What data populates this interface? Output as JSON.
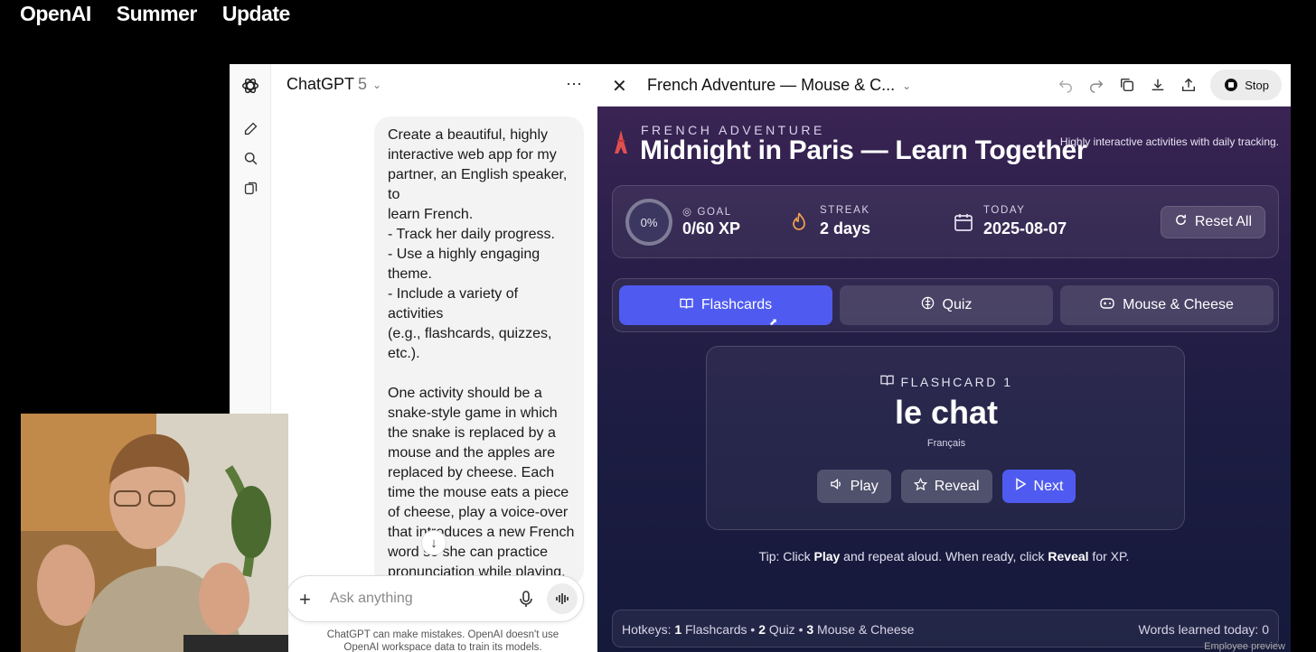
{
  "banner": {
    "words": [
      "OpenAI",
      "Summer",
      "Update"
    ]
  },
  "chat": {
    "model_name": "ChatGPT",
    "model_version": "5",
    "prompt": "Create a beautiful, highly\ninteractive web app for my\npartner, an English speaker, to\nlearn French.\n- Track her daily progress.\n- Use a highly engaging\ntheme.\n- Include a variety of activities\n(e.g., flashcards, quizzes,\netc.).\n\nOne activity should be a\nsnake-style game in which\nthe snake is replaced by a\nmouse and the apples are\nreplaced by cheese. Each\ntime the mouse eats a piece\nof cheese, play a voice-over\nthat introduces a new French\nword so she can practice\npronunciation while playing.\nMake it controllable with the\narrow keys.",
    "composer_placeholder": "Ask anything",
    "disclaimer": "ChatGPT can make mistakes. OpenAI doesn't use OpenAI workspace data to train its models."
  },
  "canvas": {
    "title": "French Adventure — Mouse & C...",
    "stop_label": "Stop",
    "eyebrow": "FRENCH ADVENTURE",
    "headline": "Midnight in Paris — Learn Together",
    "tagline": "Highly interactive activities with daily tracking.",
    "stats": {
      "progress": "0%",
      "goal_label": "GOAL",
      "goal_value": "0/60 XP",
      "streak_label": "STREAK",
      "streak_value": "2 days",
      "today_label": "TODAY",
      "today_value": "2025-08-07",
      "reset_label": "Reset All"
    },
    "tabs": [
      {
        "label": "Flashcards",
        "active": true
      },
      {
        "label": "Quiz",
        "active": false
      },
      {
        "label": "Mouse & Cheese",
        "active": false
      }
    ],
    "card": {
      "label": "FLASHCARD 1",
      "word": "le chat",
      "language": "Français",
      "play_label": "Play",
      "reveal_label": "Reveal",
      "next_label": "Next"
    },
    "tip": {
      "t1": "Tip: Click ",
      "play": "Play",
      "t2": " and repeat aloud. When ready, click ",
      "reveal": "Reveal",
      "t3": " for XP."
    },
    "footer": {
      "hotkeys_prefix": "Hotkeys: ",
      "k1": "1",
      "k1_label": " Flashcards • ",
      "k2": "2",
      "k2_label": " Quiz • ",
      "k3": "3",
      "k3_label": " Mouse & Cheese",
      "learned": "Words learned today: 0"
    },
    "employee_preview": "Employee preview"
  },
  "colors": {
    "accent": "#4f5bf0",
    "stage_top": "#3a2454",
    "stage_bottom": "#15193a"
  }
}
